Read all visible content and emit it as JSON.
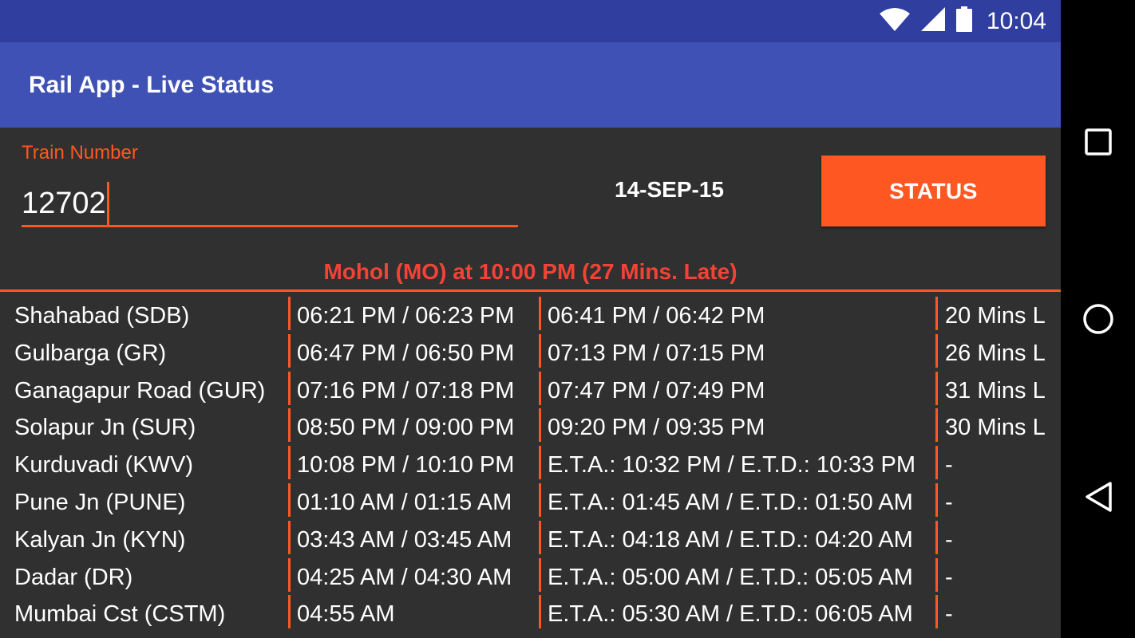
{
  "status_bar": {
    "time": "10:04",
    "icons": [
      "wifi-icon",
      "signal-icon",
      "battery-icon"
    ]
  },
  "app_bar": {
    "title": "Rail App - Live Status"
  },
  "form": {
    "train_number_label": "Train Number",
    "train_number_value": "12702",
    "date": "14-SEP-15",
    "status_button_label": "STATUS"
  },
  "live_status": "Mohol (MO) at 10:00 PM (27 Mins. Late)",
  "schedule": {
    "rows": [
      {
        "station": "Shahabad (SDB)",
        "scheduled": "06:21 PM / 06:23 PM",
        "actual": "06:41 PM / 06:42 PM",
        "delay": "20 Mins L"
      },
      {
        "station": "Gulbarga (GR)",
        "scheduled": "06:47 PM / 06:50 PM",
        "actual": "07:13 PM / 07:15 PM",
        "delay": "26 Mins L"
      },
      {
        "station": "Ganagapur Road (GUR)",
        "scheduled": "07:16 PM / 07:18 PM",
        "actual": "07:47 PM / 07:49 PM",
        "delay": "31 Mins L"
      },
      {
        "station": "Solapur Jn (SUR)",
        "scheduled": "08:50 PM / 09:00 PM",
        "actual": "09:20 PM / 09:35 PM",
        "delay": "30 Mins L"
      },
      {
        "station": "Kurduvadi (KWV)",
        "scheduled": "10:08 PM / 10:10 PM",
        "actual": "E.T.A.: 10:32 PM / E.T.D.: 10:33 PM",
        "delay": "-"
      },
      {
        "station": "Pune Jn (PUNE)",
        "scheduled": "01:10 AM / 01:15 AM",
        "actual": "E.T.A.: 01:45 AM / E.T.D.: 01:50 AM",
        "delay": "-"
      },
      {
        "station": "Kalyan Jn (KYN)",
        "scheduled": "03:43 AM / 03:45 AM",
        "actual": "E.T.A.: 04:18 AM / E.T.D.: 04:20 AM",
        "delay": "-"
      },
      {
        "station": "Dadar (DR)",
        "scheduled": "04:25 AM / 04:30 AM",
        "actual": "E.T.A.: 05:00 AM / E.T.D.: 05:05 AM",
        "delay": "-"
      },
      {
        "station": "Mumbai Cst (CSTM)",
        "scheduled": "04:55 AM",
        "actual": "E.T.A.: 05:30 AM / E.T.D.: 06:05 AM",
        "delay": "-"
      }
    ]
  },
  "nav_bar": {
    "buttons": [
      "recents-icon",
      "home-icon",
      "back-icon"
    ]
  },
  "colors": {
    "status_bar": "#303f9f",
    "app_bar": "#3f51b5",
    "accent": "#ff5722",
    "live_status": "#f44336",
    "background": "#303030"
  }
}
